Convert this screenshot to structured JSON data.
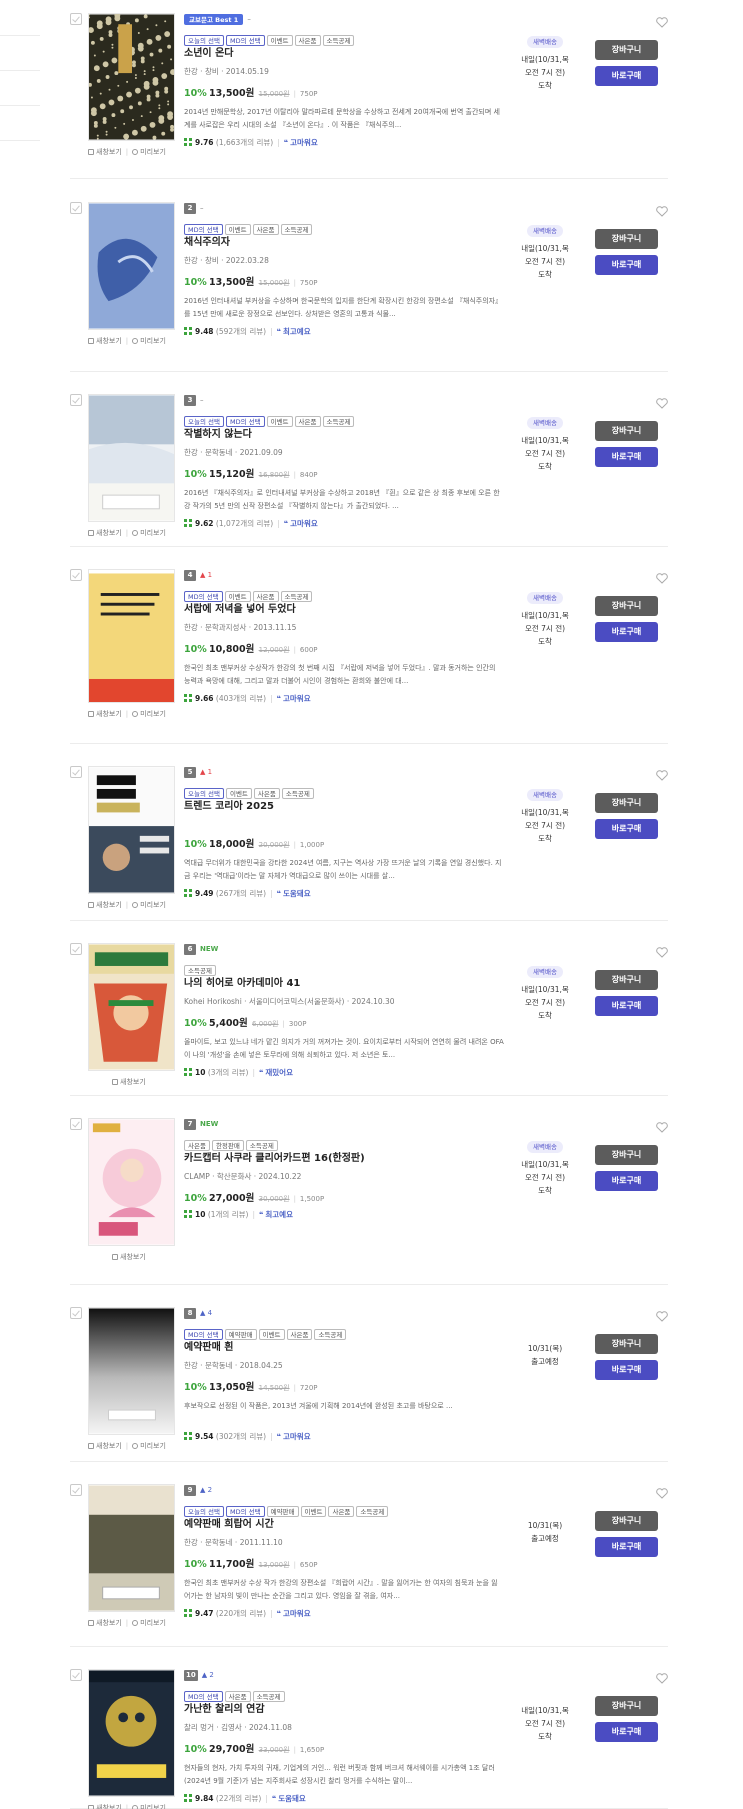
{
  "links": {
    "detail": "새창보기",
    "preview": "미리보기"
  },
  "labels": {
    "dawn": "새벽배송",
    "cart": "장바구니",
    "buy": "바로구매",
    "reviews_unit": "개의 리뷰"
  },
  "colors": {
    "cart_button": "#5c5c5c",
    "buy_button": "#4b4cc2",
    "discount": "#3ca43c",
    "keyword": "#4e64c6"
  },
  "items": [
    {
      "rank": "",
      "change": "–",
      "badge": "교보문고 Best 1",
      "tags": [
        "오늘의 선택",
        "MD의 선택",
        "이벤트",
        "사은품",
        "소득공제"
      ],
      "title": "소년이 온다",
      "meta": "한강 · 창비 · 2014.05.19",
      "discount": "10%",
      "price": "13,500원",
      "original": "15,000원",
      "points": "750P",
      "description": "2014년 만해문학상, 2017년 이탈리아 말라파르테 문학상을 수상하고 전세계 20여개국에 번역 출간되며 세계를 사로잡은 우리 시대의 소설 『소년이 온다』. 이 작품은 『채식주의...",
      "score": "9.76",
      "reviews": "(1,663개의 리뷰)",
      "keyword": "고마워요",
      "delivery": {
        "dawn": true,
        "line1": "내일(10/31,목",
        "line2": "오전 7시 전)",
        "line3": "도착"
      }
    },
    {
      "rank": "2",
      "change": "–",
      "badge": "",
      "tags": [
        "MD의 선택",
        "이벤트",
        "사은품",
        "소득공제"
      ],
      "title": "채식주의자",
      "meta": "한강 · 창비 · 2022.03.28",
      "discount": "10%",
      "price": "13,500원",
      "original": "15,000원",
      "points": "750P",
      "description": "2016년 인터내셔널 부커상을 수상하며 한국문학의 입지를 한단계 확장시킨 한강의 장편소설 『채식주의자』를 15년 만에 새로운 장정으로 선보인다. 상처받은 영혼의 고통과 식물...",
      "score": "9.48",
      "reviews": "(592개의 리뷰)",
      "keyword": "최고예요",
      "delivery": {
        "dawn": true,
        "line1": "내일(10/31,목",
        "line2": "오전 7시 전)",
        "line3": "도착"
      }
    },
    {
      "rank": "3",
      "change": "–",
      "badge": "",
      "tags": [
        "오늘의 선택",
        "MD의 선택",
        "이벤트",
        "사은품",
        "소득공제"
      ],
      "title": "작별하지 않는다",
      "meta": "한강 · 문학동네 · 2021.09.09",
      "discount": "10%",
      "price": "15,120원",
      "original": "16,800원",
      "points": "840P",
      "description": "2016년 『채식주의자』로 인터내셔널 부커상을 수상하고 2018년 『흰』으로 같은 상 최종 후보에 오른 한강 작가의 5년 만의 신작 장편소설 『작별하지 않는다』가 출간되었다. ...",
      "score": "9.62",
      "reviews": "(1,072개의 리뷰)",
      "keyword": "고마워요",
      "delivery": {
        "dawn": true,
        "line1": "내일(10/31,목",
        "line2": "오전 7시 전)",
        "line3": "도착"
      }
    },
    {
      "rank": "4",
      "change": "▲ 1",
      "badge": "",
      "tags": [
        "MD의 선택",
        "이벤트",
        "사은품",
        "소득공제"
      ],
      "title": "서랍에 저녁을 넣어 두었다",
      "meta": "한강 · 문학과지성사 · 2013.11.15",
      "discount": "10%",
      "price": "10,800원",
      "original": "12,000원",
      "points": "600P",
      "description": "한국인 최초 맨부커상 수상작가 한강의 첫 번째 시집 『서랍에 저녁을 넣어 두었다』. 말과 동거하는 인간의 능력과 욕망에 대해, 그리고 말과 더불어 시인이 경험하는 환희와 불안에 대...",
      "score": "9.66",
      "reviews": "(403개의 리뷰)",
      "keyword": "고마워요",
      "delivery": {
        "dawn": true,
        "line1": "내일(10/31,목",
        "line2": "오전 7시 전)",
        "line3": "도착"
      }
    },
    {
      "rank": "5",
      "change": "▲ 1",
      "badge": "",
      "tags": [
        "오늘의 선택",
        "이벤트",
        "사은품",
        "소득공제"
      ],
      "title": "트렌드 코리아 2025",
      "meta": "",
      "discount": "10%",
      "price": "18,000원",
      "original": "20,000원",
      "points": "1,000P",
      "description": "역대급 무더위가 대한민국을 강타한 2024년 여름, 지구는 역사상 가장 뜨거운 날의 기록을 연일 경신했다. 지금 우리는 '역대급'이라는 말 자체가 역대급으로 많이 쓰이는 시대를 살...",
      "score": "9.49",
      "reviews": "(267개의 리뷰)",
      "keyword": "도움돼요",
      "delivery": {
        "dawn": true,
        "line1": "내일(10/31,목",
        "line2": "오전 7시 전)",
        "line3": "도착"
      }
    },
    {
      "rank": "6",
      "change": "NEW",
      "badge": "",
      "tags": [
        "소득공제"
      ],
      "title": "나의 히어로 아카데미아 41",
      "meta": "Kohei Horikoshi · 서울미디어코믹스(서울문화사) · 2024.10.30",
      "discount": "10%",
      "price": "5,400원",
      "original": "6,000원",
      "points": "300P",
      "description": "올마이트, 보고 있느냐 네가 맡긴 의지가 거의 꺼져가는 것이. 요이치로부터 시작되어 연연히 물려 내려온 OFA이 나의 '개성'을 손에 넣은 토무라에 의해 쇠퇴하고 있다. 저 소년은 토...",
      "score": "10",
      "reviews": "(3개의 리뷰)",
      "keyword": "재밌어요",
      "delivery": {
        "dawn": true,
        "line1": "내일(10/31,목",
        "line2": "오전 7시 전)",
        "line3": "도착"
      }
    },
    {
      "rank": "7",
      "change": "NEW",
      "badge": "",
      "tags": [
        "사은품",
        "한정판매",
        "소득공제"
      ],
      "title": "카드캡터 사쿠라 클리어카드편 16(한정판)",
      "meta": "CLAMP · 학산문화사 · 2024.10.22",
      "discount": "10%",
      "price": "27,000원",
      "original": "30,000원",
      "points": "1,500P",
      "description": "",
      "score": "10",
      "reviews": "(1개의 리뷰)",
      "keyword": "최고예요",
      "delivery": {
        "dawn": true,
        "line1": "내일(10/31,목",
        "line2": "오전 7시 전)",
        "line3": "도착"
      }
    },
    {
      "rank": "8",
      "change": "▲ 4",
      "badge": "",
      "tags": [
        "MD의 선택",
        "예약판매",
        "이벤트",
        "사은품",
        "소득공제"
      ],
      "title": "예약판매 흰",
      "meta": "한강 · 문학동네 · 2018.04.25",
      "discount": "10%",
      "price": "13,050원",
      "original": "14,500원",
      "points": "720P",
      "description": "후보작으로 선정된 이 작품은, 2013년 겨울에 기획해 2014년에 완성된 초고를 바탕으로 ...",
      "score": "9.54",
      "reviews": "(302개의 리뷰)",
      "keyword": "고마워요",
      "delivery": {
        "dawn": false,
        "line1": "10/31(목)",
        "line2": "출고예정",
        "line3": ""
      }
    },
    {
      "rank": "9",
      "change": "▲ 2",
      "badge": "",
      "tags": [
        "오늘의 선택",
        "MD의 선택",
        "예약판매",
        "이벤트",
        "사은품",
        "소득공제"
      ],
      "title": "예약판매 희랍어 시간",
      "meta": "한강 · 문학동네 · 2011.11.10",
      "discount": "10%",
      "price": "11,700원",
      "original": "13,000원",
      "points": "650P",
      "description": "한국인 최초 맨부커상 수상 작가 한강의 장편소설 『희랍어 시간』. 말을 잃어가는 한 여자의 침묵과 눈을 잃어가는 한 남자의 빛이 만나는 순간을 그리고 있다. 영임을 잘 겪을, 여자...",
      "score": "9.47",
      "reviews": "(220개의 리뷰)",
      "keyword": "고마워요",
      "delivery": {
        "dawn": false,
        "line1": "10/31(목)",
        "line2": "출고예정",
        "line3": ""
      }
    },
    {
      "rank": "10",
      "change": "▲ 2",
      "badge": "",
      "tags": [
        "MD의 선택",
        "사은품",
        "소득공제"
      ],
      "title": "가난한 찰리의 연감",
      "meta": "찰리 멍거 · 김영사 · 2024.11.08",
      "discount": "10%",
      "price": "29,700원",
      "original": "33,000원",
      "points": "1,650P",
      "description": "현자들의 현자, 가치 투자의 귀재, 기업계의 거인... 워런 버핏과 함께 버크셔 해서웨이를 시가총액 1조 달러(2024년 9월 기준)가 넘는 지주회사로 성장시킨 찰리 멍거를 수식하는 말이...",
      "score": "9.84",
      "reviews": "(22개의 리뷰)",
      "keyword": "도움돼요",
      "delivery": {
        "dawn": false,
        "line1": "내일(10/31,목",
        "line2": "오전 7시 전)",
        "line3": "도착"
      }
    }
  ]
}
